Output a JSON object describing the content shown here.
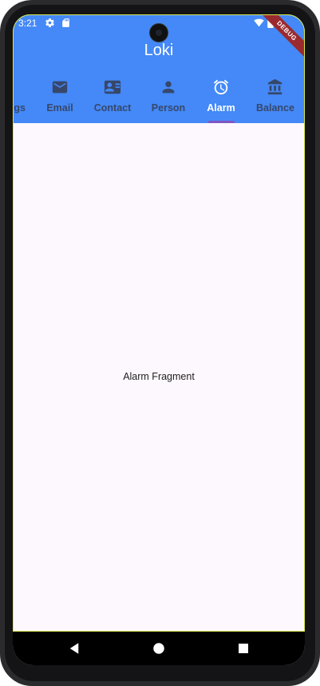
{
  "status_bar": {
    "time": "3:21",
    "icons": [
      "gear-icon",
      "sd-card-icon",
      "wifi-icon",
      "battery-icon"
    ]
  },
  "app_bar": {
    "title": "Loki",
    "debug_banner": "DEBUG",
    "background_color": "#4489f7"
  },
  "tabs": [
    {
      "label": "Settings",
      "icon": "settings-icon",
      "active": false
    },
    {
      "label": "Email",
      "icon": "email-icon",
      "active": false
    },
    {
      "label": "Contact",
      "icon": "contact-card-icon",
      "active": false
    },
    {
      "label": "Person",
      "icon": "person-icon",
      "active": false
    },
    {
      "label": "Alarm",
      "icon": "alarm-icon",
      "active": true
    },
    {
      "label": "Balance",
      "icon": "bank-icon",
      "active": false
    }
  ],
  "content": {
    "text": "Alarm Fragment"
  },
  "nav_bar": {
    "buttons": [
      "back-icon",
      "home-icon",
      "recents-icon"
    ]
  },
  "colors": {
    "tab_indicator": "#7e57c2",
    "inactive_tab": "#37476a",
    "active_tab": "#ffffff"
  }
}
